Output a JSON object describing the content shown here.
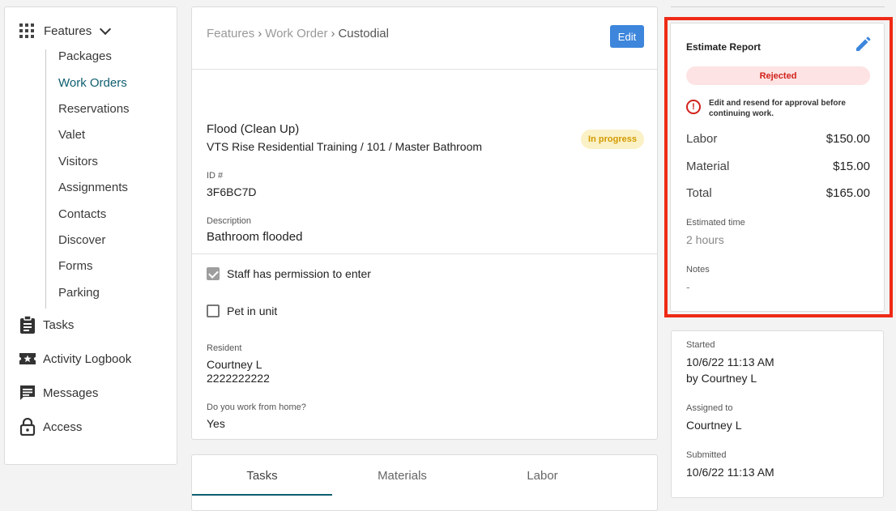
{
  "sidebar": {
    "features_label": "Features",
    "sub_items": [
      "Packages",
      "Work Orders",
      "Reservations",
      "Valet",
      "Visitors",
      "Assignments",
      "Contacts",
      "Discover",
      "Forms",
      "Parking"
    ],
    "active_sub_item": "Work Orders",
    "main_items": [
      {
        "label": "Tasks",
        "icon": "clipboard-icon"
      },
      {
        "label": "Activity Logbook",
        "icon": "star-ticket-icon"
      },
      {
        "label": "Messages",
        "icon": "message-icon"
      },
      {
        "label": "Access",
        "icon": "lock-icon"
      }
    ]
  },
  "detail": {
    "breadcrumb": [
      "Features",
      "Work Order",
      "Custodial"
    ],
    "edit_label": "Edit",
    "title": "Flood (Clean Up)",
    "location": "VTS Rise Residential Training / 101 / Master Bathroom",
    "status": "In progress",
    "id_label": "ID #",
    "id_value": "3F6BC7D",
    "description_label": "Description",
    "description_value": "Bathroom flooded",
    "permission_label": "Staff has permission to enter",
    "permission_checked": true,
    "pet_label": "Pet in unit",
    "pet_checked": false,
    "resident_label": "Resident",
    "resident_name": "Courtney L",
    "resident_phone": "2222222222",
    "wfh_label": "Do you work from home?",
    "wfh_value": "Yes"
  },
  "tabs": [
    "Tasks",
    "Materials",
    "Labor"
  ],
  "active_tab": "Tasks",
  "estimate": {
    "title": "Estimate Report",
    "status": "Rejected",
    "warning": "Edit and resend for approval before continuing work.",
    "labor_label": "Labor",
    "labor_value": "$150.00",
    "material_label": "Material",
    "material_value": "$15.00",
    "total_label": "Total",
    "total_value": "$165.00",
    "estimated_time_label": "Estimated time",
    "estimated_time_value": "2 hours",
    "notes_label": "Notes",
    "notes_value": "-"
  },
  "info": {
    "started_label": "Started",
    "started_value": "10/6/22 11:13 AM",
    "started_by": "by Courtney L",
    "assigned_label": "Assigned to",
    "assigned_value": "Courtney L",
    "submitted_label": "Submitted",
    "submitted_value": "10/6/22 11:13 AM"
  },
  "colors": {
    "accent_teal": "#0e5e6f",
    "edit_blue": "#3d86dc",
    "rejected_red": "#d1201a",
    "highlight_red": "#ee2a16",
    "progress_yellow": "#d29a00"
  }
}
